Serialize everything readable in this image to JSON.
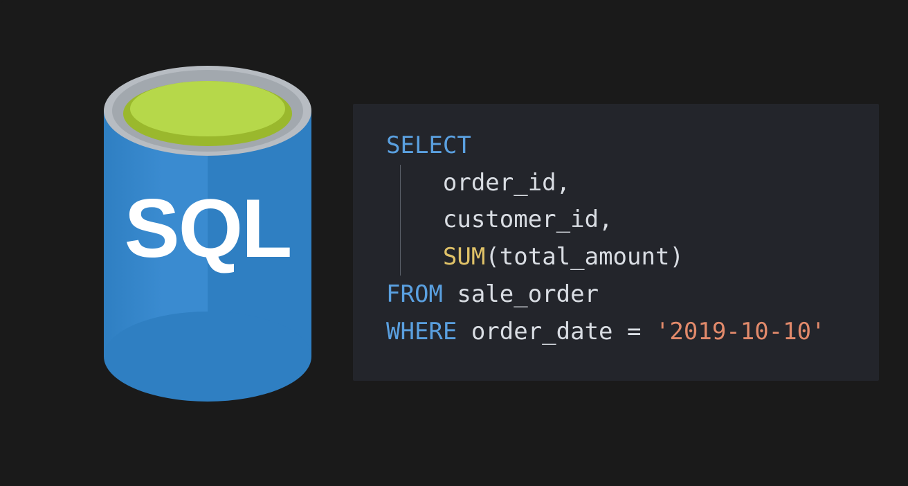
{
  "colors": {
    "bg": "#1a1a1a",
    "panel": "#23252b",
    "code_default": "#d9dde3",
    "code_keyword": "#5aa0e0",
    "code_function": "#e0c268",
    "code_string": "#e28a6b",
    "db_blue_light": "#3a8bd0",
    "db_blue_dark": "#2f7fc2",
    "db_rim": "#b7bcc2",
    "db_liquid": "#b6d84a"
  },
  "db": {
    "label": "SQL"
  },
  "code": {
    "kw_select": "SELECT",
    "line_order_id": "    order_id,",
    "line_customer_id": "    customer_id,",
    "indent": "    ",
    "fn_sum": "SUM",
    "sum_args_open": "(",
    "sum_args_inner": "total_amount",
    "sum_args_close": ")",
    "kw_from": "FROM",
    "from_table": " sale_order",
    "kw_where": "WHERE",
    "where_left": " order_date = ",
    "where_value": "'2019-10-10'"
  }
}
